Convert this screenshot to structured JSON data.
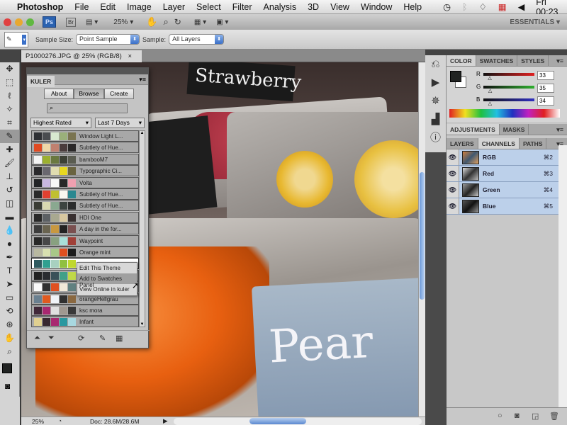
{
  "menubar": {
    "apple": "apple-icon",
    "app": "Photoshop",
    "items": [
      "File",
      "Edit",
      "Image",
      "Layer",
      "Select",
      "Filter",
      "Analysis",
      "3D",
      "View",
      "Window",
      "Help"
    ],
    "clock": "Fri 00:23"
  },
  "appbar": {
    "ps": "Ps",
    "br": "Br",
    "zoom": "25%",
    "workspace": "ESSENTIALS ▾"
  },
  "options": {
    "sample_size_label": "Sample Size:",
    "sample_size": "Point Sample",
    "sample_label": "Sample:",
    "sample": "All Layers"
  },
  "document": {
    "tab": "P1000276.JPG @ 25% (RGB/8)",
    "close": "×",
    "photo_signs": [
      "Strawberry",
      "Pear"
    ]
  },
  "status": {
    "zoom": "25%",
    "doc": "Doc: 28.6M/28.6M"
  },
  "tools": [
    "move",
    "marquee",
    "lasso",
    "quick-select",
    "crop",
    "eyedropper",
    "healing",
    "brush",
    "clone-stamp",
    "history-brush",
    "eraser",
    "gradient",
    "blur",
    "dodge",
    "pen",
    "type",
    "path-select",
    "shape",
    "3d-rotate",
    "3d-orbit",
    "hand",
    "zoom"
  ],
  "color_panel": {
    "tabs": [
      "COLOR",
      "SWATCHES",
      "STYLES"
    ],
    "r_label": "R",
    "g_label": "G",
    "b_label": "B",
    "r": "33",
    "g": "35",
    "b": "34"
  },
  "adjust_tabs": [
    "ADJUSTMENTS",
    "MASKS"
  ],
  "channels_panel": {
    "tabs": [
      "LAYERS",
      "CHANNELS",
      "PATHS"
    ],
    "channels": [
      {
        "name": "RGB",
        "shortcut": "⌘2"
      },
      {
        "name": "Red",
        "shortcut": "⌘3"
      },
      {
        "name": "Green",
        "shortcut": "⌘4"
      },
      {
        "name": "Blue",
        "shortcut": "⌘5"
      }
    ]
  },
  "kuler": {
    "title": "KULER",
    "tabs": [
      "About",
      "Browse",
      "Create"
    ],
    "active_tab": "Browse",
    "search_placeholder": "",
    "sort": "Highest Rated",
    "period": "Last 7 Days",
    "themes": [
      {
        "name": "Window Light L...",
        "colors": [
          "#2e3034",
          "#4a4c50",
          "#d8e8d0",
          "#9ab07a",
          "#7a7450"
        ]
      },
      {
        "name": "Subtlety of Hue...",
        "colors": [
          "#e04a22",
          "#f0d8a8",
          "#c08070",
          "#4a3c3c",
          "#2a2828"
        ]
      },
      {
        "name": "bambooM7",
        "colors": [
          "#f4f4f4",
          "#9cb030",
          "#6a7840",
          "#3c4034",
          "#5a5c50"
        ]
      },
      {
        "name": "Typographic Ci...",
        "colors": [
          "#2a2a2c",
          "#6a6870",
          "#e0dcb0",
          "#e8d820",
          "#6a6440"
        ]
      },
      {
        "name": "Volta",
        "colors": [
          "#222426",
          "#c8b8e0",
          "#f8f8f8",
          "#282828",
          "#f0a0b0"
        ]
      },
      {
        "name": "Subtlety of Hue...",
        "colors": [
          "#2a2a2a",
          "#e04030",
          "#c0c030",
          "#f8f8f0",
          "#2a8890"
        ]
      },
      {
        "name": "Subtlety of Hue...",
        "colors": [
          "#3a3c34",
          "#d8d8b0",
          "#8aa890",
          "#3c4440",
          "#2a2c2c"
        ]
      },
      {
        "name": "HDI One",
        "colors": [
          "#282828",
          "#5c6064",
          "#a8a890",
          "#d8c8a0",
          "#383030"
        ]
      },
      {
        "name": "A day in the for...",
        "colors": [
          "#3c3c3c",
          "#6a6450",
          "#c89840",
          "#222222",
          "#7a5050"
        ]
      },
      {
        "name": "Waypoint",
        "colors": [
          "#282828",
          "#484848",
          "#88a080",
          "#a8e0d8",
          "#a04038"
        ]
      },
      {
        "name": "Orange mint",
        "colors": [
          "#b8b8a0",
          "#d8e0b0",
          "#a8c888",
          "#e05020",
          "#1c1c1c"
        ]
      },
      {
        "name": "",
        "colors": [
          "#305a60",
          "#30a090",
          "#a8d0c0",
          "#90c040",
          "#c0d830"
        ],
        "selected": true
      },
      {
        "name": "",
        "colors": [
          "#222222",
          "#2a2c30",
          "#3a5058",
          "#40a088",
          "#c0d848"
        ]
      },
      {
        "name": "",
        "colors": [
          "#fafafa",
          "#303030",
          "#e05020",
          "#f0e8d8",
          "#608080"
        ]
      },
      {
        "name": "orangeHellgrau",
        "colors": [
          "#6a8090",
          "#e05a20",
          "#f0f4f8",
          "#303030",
          "#8a6840"
        ]
      },
      {
        "name": "ksc mora",
        "colors": [
          "#402838",
          "#a82870",
          "#e0e0e0",
          "#a09890",
          "#383838"
        ]
      },
      {
        "name": "Infant",
        "colors": [
          "#e0d090",
          "#382830",
          "#a82870",
          "#2898a0",
          "#a8d8e0"
        ]
      }
    ],
    "context_menu": [
      "Edit This Theme",
      "Add to Swatches Panel",
      "View Online in kuler"
    ],
    "highlighted_menu_item": "Add to Swatches Panel"
  }
}
